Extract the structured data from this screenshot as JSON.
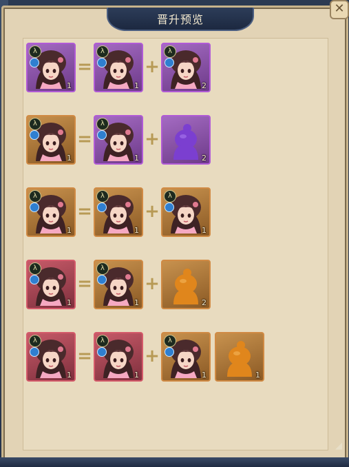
{
  "window": {
    "title": "晋升预览"
  },
  "rows": [
    {
      "result": {
        "frame": "purple",
        "type": "hero",
        "qty": "1"
      },
      "op1": "=",
      "a": {
        "frame": "purple",
        "type": "hero",
        "qty": "1"
      },
      "op2": "+",
      "b": {
        "frame": "purple",
        "type": "hero",
        "qty": "2"
      }
    },
    {
      "result": {
        "frame": "orange",
        "type": "hero",
        "qty": "1"
      },
      "op1": "=",
      "a": {
        "frame": "purple",
        "type": "hero",
        "qty": "1"
      },
      "op2": "+",
      "b": {
        "frame": "purple",
        "type": "silhouette",
        "qty": "2"
      }
    },
    {
      "result": {
        "frame": "orange",
        "type": "hero",
        "qty": "1"
      },
      "op1": "=",
      "a": {
        "frame": "orange",
        "type": "hero",
        "qty": "1"
      },
      "op2": "+",
      "b": {
        "frame": "orange",
        "type": "hero",
        "qty": "1"
      }
    },
    {
      "result": {
        "frame": "red",
        "type": "hero",
        "qty": "1"
      },
      "op1": "=",
      "a": {
        "frame": "orange",
        "type": "hero",
        "qty": "1"
      },
      "op2": "+",
      "b": {
        "frame": "orange",
        "type": "silhouette",
        "qty": "2"
      }
    },
    {
      "result": {
        "frame": "red",
        "type": "hero",
        "qty": "1"
      },
      "op1": "=",
      "a": {
        "frame": "red",
        "type": "hero",
        "qty": "1"
      },
      "op2": "+",
      "b": {
        "frame": "orange",
        "type": "hero",
        "qty": "1"
      },
      "c": {
        "frame": "orange",
        "type": "silhouette",
        "qty": "1"
      }
    }
  ],
  "badge_symbol": "λ",
  "colors": {
    "purple": "#b05ad6",
    "orange": "#d08a44",
    "red": "#d45a6a"
  },
  "icons": {
    "close": "close-icon",
    "badge": "class-badge-icon",
    "element": "water-element-icon"
  }
}
